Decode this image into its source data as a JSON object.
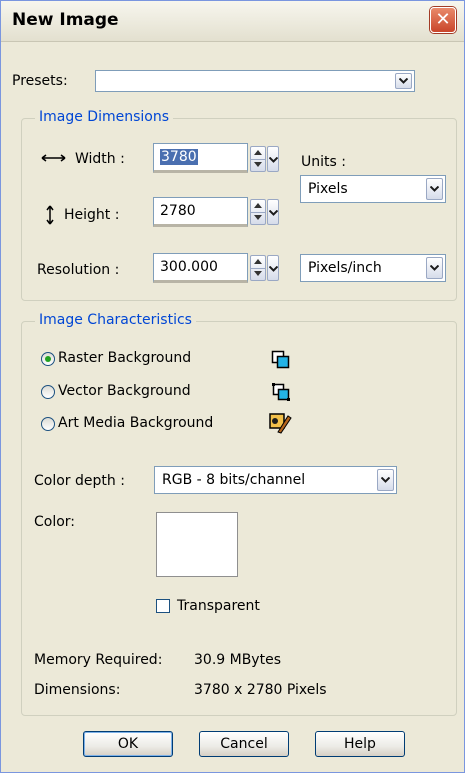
{
  "window": {
    "title": "New Image"
  },
  "presets": {
    "label": "Presets:",
    "value": ""
  },
  "dimensions": {
    "legend": "Image Dimensions",
    "width_label": "Width :",
    "width_value": "3780",
    "height_label": "Height :",
    "height_value": "2780",
    "units_label": "Units :",
    "units_value": "Pixels",
    "resolution_label": "Resolution :",
    "resolution_value": "300.000",
    "resolution_units": "Pixels/inch"
  },
  "characteristics": {
    "legend": "Image Characteristics",
    "backgrounds": [
      {
        "label": "Raster Background",
        "selected": true
      },
      {
        "label": "Vector Background",
        "selected": false
      },
      {
        "label": "Art Media Background",
        "selected": false
      }
    ],
    "color_depth_label": "Color depth :",
    "color_depth_value": "RGB - 8 bits/channel",
    "color_label": "Color:",
    "color_value": "#ffffff",
    "transparent_label": "Transparent",
    "memory_label": "Memory Required:",
    "memory_value": "30.9 MBytes",
    "dims_label": "Dimensions:",
    "dims_value": "3780 x 2780 Pixels"
  },
  "buttons": {
    "ok": "OK",
    "cancel": "Cancel",
    "help": "Help"
  },
  "colors": {
    "title_close": "#d2502e",
    "legend_text": "#0046d5",
    "radio_dot": "#21a121"
  }
}
